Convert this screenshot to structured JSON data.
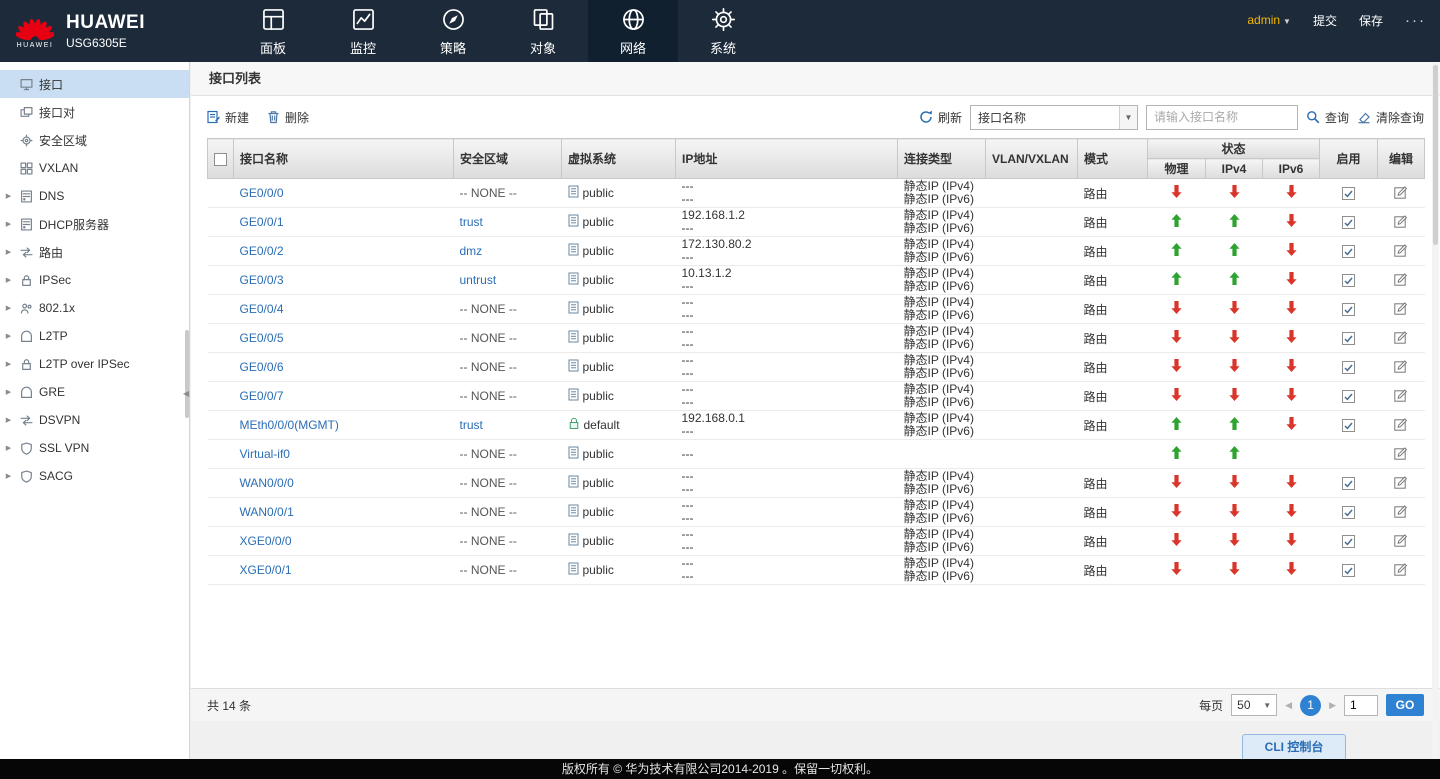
{
  "brand": {
    "name": "HUAWEI",
    "model": "USG6305E",
    "logo_word": "HUAWEI",
    "logo_color": "#e60012"
  },
  "topbar": {
    "user": "admin",
    "commit": "提交",
    "save": "保存",
    "more": "···",
    "items": [
      {
        "label": "面板",
        "icon": "dashboard-icon",
        "active": false
      },
      {
        "label": "监控",
        "icon": "monitor-icon",
        "active": false
      },
      {
        "label": "策略",
        "icon": "policy-icon",
        "active": false
      },
      {
        "label": "对象",
        "icon": "object-icon",
        "active": false
      },
      {
        "label": "网络",
        "icon": "network-icon",
        "active": true
      },
      {
        "label": "系统",
        "icon": "system-icon",
        "active": false
      }
    ]
  },
  "sidebar": {
    "items": [
      {
        "key": "interface",
        "label": "接口",
        "icon": "monitor",
        "expandable": false,
        "active": true
      },
      {
        "key": "interface-pair",
        "label": "接口对",
        "icon": "pair",
        "expandable": false,
        "active": false
      },
      {
        "key": "security-zone",
        "label": "安全区域",
        "icon": "gear",
        "expandable": false,
        "active": false
      },
      {
        "key": "vxlan",
        "label": "VXLAN",
        "icon": "grid",
        "expandable": false,
        "active": false
      },
      {
        "key": "dns",
        "label": "DNS",
        "icon": "server",
        "expandable": true,
        "active": false
      },
      {
        "key": "dhcp-server",
        "label": "DHCP服务器",
        "icon": "server",
        "expandable": true,
        "active": false
      },
      {
        "key": "route",
        "label": "路由",
        "icon": "route",
        "expandable": true,
        "active": false
      },
      {
        "key": "ipsec",
        "label": "IPSec",
        "icon": "lock",
        "expandable": true,
        "active": false
      },
      {
        "key": "dot1x",
        "label": "802.1x",
        "icon": "users",
        "expandable": true,
        "active": false
      },
      {
        "key": "l2tp",
        "label": "L2TP",
        "icon": "tunnel",
        "expandable": true,
        "active": false
      },
      {
        "key": "l2tp-over-ipsec",
        "label": "L2TP over IPSec",
        "icon": "lock",
        "expandable": true,
        "active": false
      },
      {
        "key": "gre",
        "label": "GRE",
        "icon": "tunnel",
        "expandable": true,
        "active": false
      },
      {
        "key": "dsvpn",
        "label": "DSVPN",
        "icon": "route",
        "expandable": true,
        "active": false
      },
      {
        "key": "ssl-vpn",
        "label": "SSL VPN",
        "icon": "shield",
        "expandable": true,
        "active": false
      },
      {
        "key": "sacg",
        "label": "SACG",
        "icon": "shield",
        "expandable": true,
        "active": false
      }
    ]
  },
  "main": {
    "title": "接口列表",
    "toolbar": {
      "new": "新建",
      "delete": "删除",
      "refresh": "刷新",
      "filter_selected": "接口名称",
      "search_placeholder": "请输入接口名称",
      "query": "查询",
      "clear_query": "清除查询"
    },
    "table": {
      "headers": {
        "name": "接口名称",
        "zone": "安全区域",
        "vsys": "虚拟系统",
        "ip": "IP地址",
        "conn": "连接类型",
        "vlan": "VLAN/VXLAN",
        "mode": "模式",
        "status": "状态",
        "phy": "物理",
        "ipv4": "IPv4",
        "ipv6": "IPv6",
        "enable": "启用",
        "edit": "编辑"
      },
      "rows": [
        {
          "name": "GE0/0/0",
          "zone": "-- NONE --",
          "zone_is_link": false,
          "vsys": "public",
          "vsys_icon": "public-vsys-icon",
          "ip": [
            "---",
            "---"
          ],
          "conn": [
            "静态IP (IPv4)",
            "静态IP (IPv6)"
          ],
          "vlan": "",
          "mode": "路由",
          "phy": "down",
          "ipv4": "down",
          "ipv6": "down",
          "enabled": true,
          "editable": true
        },
        {
          "name": "GE0/0/1",
          "zone": "trust",
          "zone_is_link": true,
          "vsys": "public",
          "vsys_icon": "public-vsys-icon",
          "ip": [
            "192.168.1.2",
            "---"
          ],
          "conn": [
            "静态IP (IPv4)",
            "静态IP (IPv6)"
          ],
          "vlan": "",
          "mode": "路由",
          "phy": "up",
          "ipv4": "up",
          "ipv6": "down",
          "enabled": true,
          "editable": true
        },
        {
          "name": "GE0/0/2",
          "zone": "dmz",
          "zone_is_link": true,
          "vsys": "public",
          "vsys_icon": "public-vsys-icon",
          "ip": [
            "172.130.80.2",
            "---"
          ],
          "conn": [
            "静态IP (IPv4)",
            "静态IP (IPv6)"
          ],
          "vlan": "",
          "mode": "路由",
          "phy": "up",
          "ipv4": "up",
          "ipv6": "down",
          "enabled": true,
          "editable": true
        },
        {
          "name": "GE0/0/3",
          "zone": "untrust",
          "zone_is_link": true,
          "vsys": "public",
          "vsys_icon": "public-vsys-icon",
          "ip": [
            "10.13.1.2",
            "---"
          ],
          "conn": [
            "静态IP (IPv4)",
            "静态IP (IPv6)"
          ],
          "vlan": "",
          "mode": "路由",
          "phy": "up",
          "ipv4": "up",
          "ipv6": "down",
          "enabled": true,
          "editable": true
        },
        {
          "name": "GE0/0/4",
          "zone": "-- NONE --",
          "zone_is_link": false,
          "vsys": "public",
          "vsys_icon": "public-vsys-icon",
          "ip": [
            "---",
            "---"
          ],
          "conn": [
            "静态IP (IPv4)",
            "静态IP (IPv6)"
          ],
          "vlan": "",
          "mode": "路由",
          "phy": "down",
          "ipv4": "down",
          "ipv6": "down",
          "enabled": true,
          "editable": true
        },
        {
          "name": "GE0/0/5",
          "zone": "-- NONE --",
          "zone_is_link": false,
          "vsys": "public",
          "vsys_icon": "public-vsys-icon",
          "ip": [
            "---",
            "---"
          ],
          "conn": [
            "静态IP (IPv4)",
            "静态IP (IPv6)"
          ],
          "vlan": "",
          "mode": "路由",
          "phy": "down",
          "ipv4": "down",
          "ipv6": "down",
          "enabled": true,
          "editable": true
        },
        {
          "name": "GE0/0/6",
          "zone": "-- NONE --",
          "zone_is_link": false,
          "vsys": "public",
          "vsys_icon": "public-vsys-icon",
          "ip": [
            "---",
            "---"
          ],
          "conn": [
            "静态IP (IPv4)",
            "静态IP (IPv6)"
          ],
          "vlan": "",
          "mode": "路由",
          "phy": "down",
          "ipv4": "down",
          "ipv6": "down",
          "enabled": true,
          "editable": true
        },
        {
          "name": "GE0/0/7",
          "zone": "-- NONE --",
          "zone_is_link": false,
          "vsys": "public",
          "vsys_icon": "public-vsys-icon",
          "ip": [
            "---",
            "---"
          ],
          "conn": [
            "静态IP (IPv4)",
            "静态IP (IPv6)"
          ],
          "vlan": "",
          "mode": "路由",
          "phy": "down",
          "ipv4": "down",
          "ipv6": "down",
          "enabled": true,
          "editable": true
        },
        {
          "name": "MEth0/0/0(MGMT)",
          "zone": "trust",
          "zone_is_link": true,
          "vsys": "default",
          "vsys_icon": "default-vsys-icon",
          "ip": [
            "192.168.0.1",
            "---"
          ],
          "conn": [
            "静态IP (IPv4)",
            "静态IP (IPv6)"
          ],
          "vlan": "",
          "mode": "路由",
          "phy": "up",
          "ipv4": "up",
          "ipv6": "down",
          "enabled": true,
          "editable": true
        },
        {
          "name": "Virtual-if0",
          "zone": "-- NONE --",
          "zone_is_link": false,
          "vsys": "public",
          "vsys_icon": "public-vsys-icon",
          "ip": [
            "---"
          ],
          "conn": [],
          "vlan": "",
          "mode": "",
          "phy": "up",
          "ipv4": "up",
          "ipv6": "",
          "enabled": false,
          "editable": true
        },
        {
          "name": "WAN0/0/0",
          "zone": "-- NONE --",
          "zone_is_link": false,
          "vsys": "public",
          "vsys_icon": "public-vsys-icon",
          "ip": [
            "---",
            "---"
          ],
          "conn": [
            "静态IP (IPv4)",
            "静态IP (IPv6)"
          ],
          "vlan": "",
          "mode": "路由",
          "phy": "down",
          "ipv4": "down",
          "ipv6": "down",
          "enabled": true,
          "editable": true
        },
        {
          "name": "WAN0/0/1",
          "zone": "-- NONE --",
          "zone_is_link": false,
          "vsys": "public",
          "vsys_icon": "public-vsys-icon",
          "ip": [
            "---",
            "---"
          ],
          "conn": [
            "静态IP (IPv4)",
            "静态IP (IPv6)"
          ],
          "vlan": "",
          "mode": "路由",
          "phy": "down",
          "ipv4": "down",
          "ipv6": "down",
          "enabled": true,
          "editable": true
        },
        {
          "name": "XGE0/0/0",
          "zone": "-- NONE --",
          "zone_is_link": false,
          "vsys": "public",
          "vsys_icon": "public-vsys-icon",
          "ip": [
            "---",
            "---"
          ],
          "conn": [
            "静态IP (IPv4)",
            "静态IP (IPv6)"
          ],
          "vlan": "",
          "mode": "路由",
          "phy": "down",
          "ipv4": "down",
          "ipv6": "down",
          "enabled": true,
          "editable": true
        },
        {
          "name": "XGE0/0/1",
          "zone": "-- NONE --",
          "zone_is_link": false,
          "vsys": "public",
          "vsys_icon": "public-vsys-icon",
          "ip": [
            "---",
            "---"
          ],
          "conn": [
            "静态IP (IPv4)",
            "静态IP (IPv6)"
          ],
          "vlan": "",
          "mode": "路由",
          "phy": "down",
          "ipv4": "down",
          "ipv6": "down",
          "enabled": true,
          "editable": true
        }
      ]
    },
    "pager": {
      "total": "共 14 条",
      "per_page_label": "每页",
      "per_page": "50",
      "current_page": "1",
      "page_input": "1",
      "go": "GO"
    }
  },
  "cli": {
    "label": "CLI 控制台"
  },
  "footer": {
    "copyright": "版权所有 © 华为技术有限公司2014-2019 。保留一切权利。"
  },
  "colors": {
    "accent_blue": "#2f82d2",
    "link": "#2a6db5",
    "status_up": "#2fa331",
    "status_down": "#d9352b",
    "topbar": "#1d2a3a",
    "sidebar_selected": "#c9def2"
  }
}
